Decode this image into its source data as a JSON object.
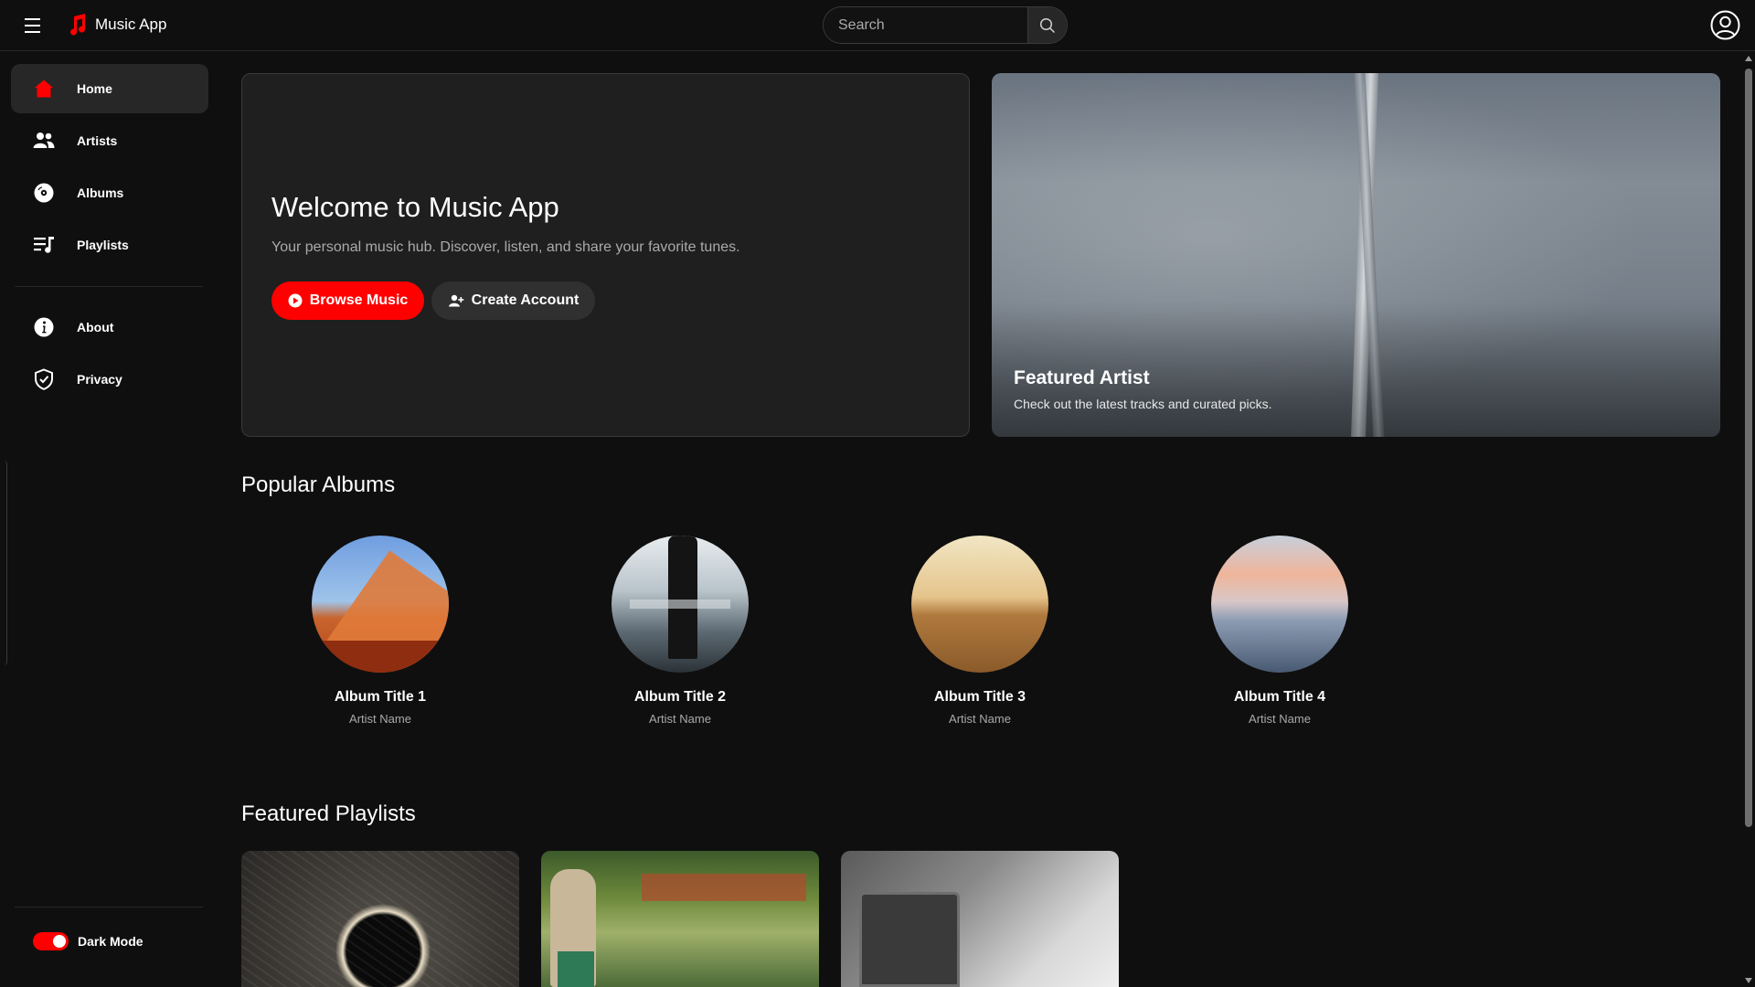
{
  "header": {
    "app_name": "Music App",
    "search": {
      "placeholder": "Search",
      "value": ""
    },
    "icons": {
      "menu": "hamburger-icon",
      "logo": "music-note-icon",
      "search": "search-icon",
      "account": "account-circle-icon"
    }
  },
  "sidebar": {
    "items": [
      {
        "label": "Home",
        "icon": "home-icon",
        "active": true
      },
      {
        "label": "Artists",
        "icon": "people-icon",
        "active": false
      },
      {
        "label": "Albums",
        "icon": "disc-icon",
        "active": false
      },
      {
        "label": "Playlists",
        "icon": "playlist-icon",
        "active": false
      },
      {
        "label": "About",
        "icon": "info-icon",
        "active": false
      },
      {
        "label": "Privacy",
        "icon": "shield-icon",
        "active": false
      }
    ],
    "dark_mode": {
      "label": "Dark Mode",
      "on": true
    }
  },
  "hero": {
    "title": "Welcome to Music App",
    "subtitle": "Your personal music hub. Discover, listen, and share your favorite tunes.",
    "primary_button": "Browse Music",
    "secondary_button": "Create Account"
  },
  "featured": {
    "title": "Featured Artist",
    "subtitle": "Check out the latest tracks and curated picks."
  },
  "albums_section": {
    "title": "Popular Albums",
    "albums": [
      {
        "title": "Album Title 1",
        "artist": "Artist Name"
      },
      {
        "title": "Album Title 2",
        "artist": "Artist Name"
      },
      {
        "title": "Album Title 3",
        "artist": "Artist Name"
      },
      {
        "title": "Album Title 4",
        "artist": "Artist Name"
      }
    ]
  },
  "playlists_section": {
    "title": "Featured Playlists"
  },
  "colors": {
    "accent": "#ff0000",
    "background": "#0f0f0f",
    "card": "#1f1f1f",
    "muted_text": "#aaaaaa"
  }
}
